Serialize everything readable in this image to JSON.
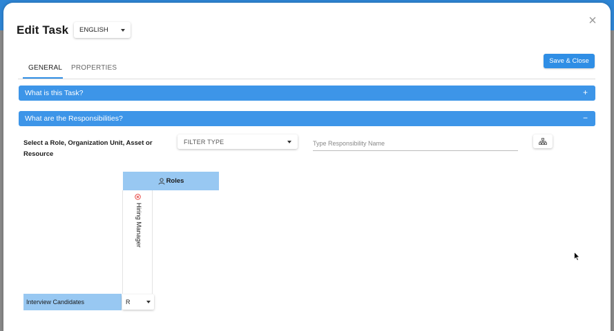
{
  "dialog": {
    "title": "Edit Task",
    "language": "ENGLISH",
    "close_glyph": "×",
    "save_label": "Save & Close"
  },
  "tabs": [
    {
      "label": "GENERAL",
      "active": true
    },
    {
      "label": "PROPERTIES",
      "active": false
    }
  ],
  "accordions": [
    {
      "label": "What is this Task?",
      "sign": "+",
      "expanded": false
    },
    {
      "label": "What are the Responsibilities?",
      "sign": "−",
      "expanded": true
    }
  ],
  "responsibilities": {
    "select_label": "Select a Role, Organization Unit, Asset or Resource",
    "filter_type": "FILTER TYPE",
    "name_placeholder": "Type Responsibility Name",
    "org_icon": "org-chart-icon"
  },
  "matrix": {
    "column_group": "Roles",
    "columns": [
      {
        "name": "Hiring Manager"
      }
    ],
    "rows": [
      {
        "task": "Interview Candidates",
        "value": "R"
      }
    ]
  },
  "colors": {
    "accent": "#3d95e8",
    "header_light": "#98c8f2",
    "remove_red": "#e53935"
  }
}
